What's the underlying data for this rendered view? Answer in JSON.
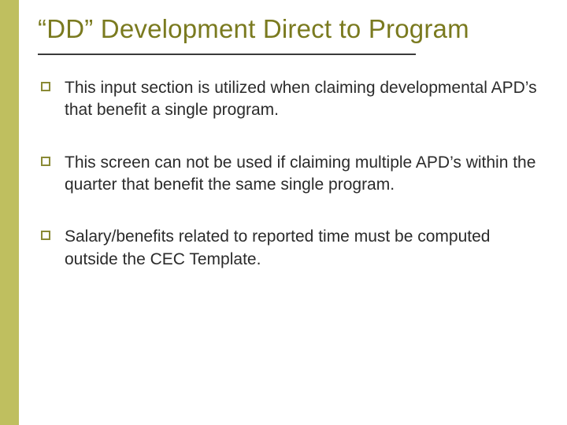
{
  "title": "“DD” Development Direct to Program",
  "bullets": [
    "This input section is utilized when claiming developmental APD’s that benefit a single program.",
    "This screen can not be used if claiming multiple APD’s within the quarter that benefit the same single program.",
    "Salary/benefits related to reported time must be computed outside the CEC Template."
  ]
}
